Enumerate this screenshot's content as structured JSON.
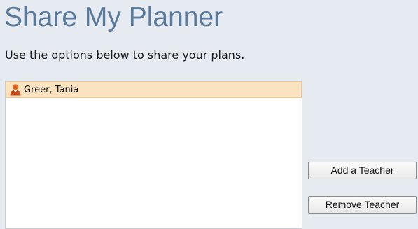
{
  "page": {
    "title": "Share My Planner",
    "instructions": "Use the options below to share your plans."
  },
  "teacher_list": {
    "items": [
      {
        "label": "Greer, Tania",
        "icon": "user-icon",
        "selected": true
      }
    ]
  },
  "actions": {
    "add_label": "Add a Teacher",
    "remove_label": "Remove Teacher"
  },
  "colors": {
    "page_background": "#e6ebf1",
    "title_color": "#5a7a9c",
    "selected_row_background": "#fbe3c0",
    "user_icon_orange": "#e0671e"
  }
}
